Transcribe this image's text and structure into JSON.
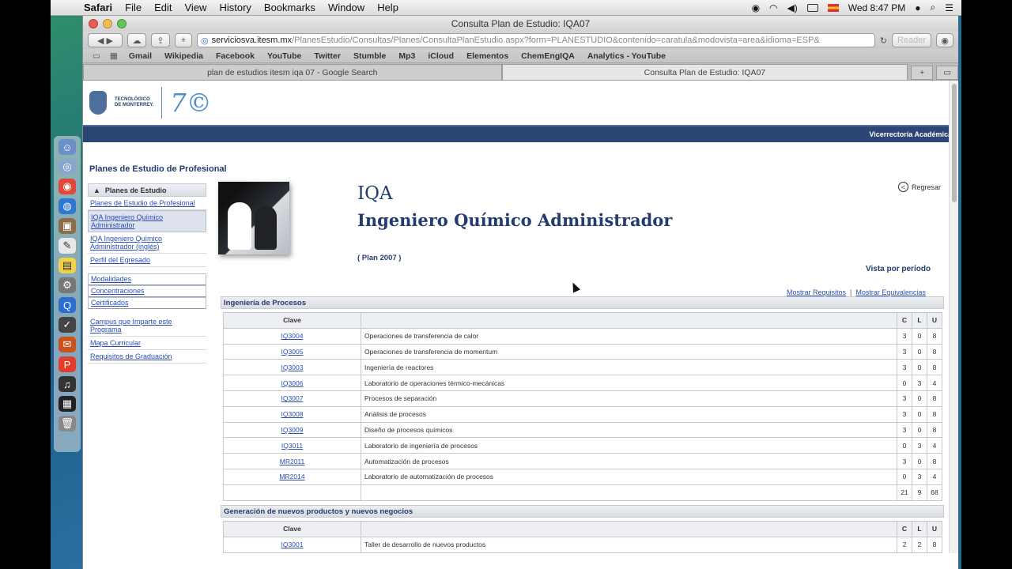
{
  "menubar": {
    "app": "Safari",
    "items": [
      "File",
      "Edit",
      "View",
      "History",
      "Bookmarks",
      "Window",
      "Help"
    ],
    "clock": "Wed 8:47 PM"
  },
  "window": {
    "title": "Consulta Plan de Estudio: IQA07"
  },
  "toolbar": {
    "url_host": "serviciosva.itesm.mx",
    "url_path": "/PlanesEstudio/Consultas/Planes/ConsultaPlanEstudio.aspx?form=PLANESTUDIO&contenido=caratula&modovista=area&idioma=ESP&",
    "reader_label": "Reader"
  },
  "bookmarks": [
    "Gmail",
    "Wikipedia",
    "Facebook",
    "YouTube",
    "Twitter",
    "Stumble",
    "Mp3",
    "iCloud",
    "Elementos",
    "ChemEngIQA",
    "Analytics - YouTube"
  ],
  "tabs": [
    {
      "label": "plan de estudios itesm iqa 07 - Google Search"
    },
    {
      "label": "Consulta Plan de Estudio: IQA07"
    }
  ],
  "page": {
    "banner_right": "Vicerrectoría Académica",
    "section_title": "Planes de Estudio de Profesional",
    "sidebar": {
      "header": "Planes de Estudio",
      "items": [
        "Planes de Estudio de Profesional",
        "IQA Ingeniero Químico Administrador",
        "IQA Ingeniero Químico Administrador (inglés)",
        "Perfil del Egresado"
      ],
      "boxes": [
        "Modalidades",
        "Concentraciones",
        "Certificados"
      ],
      "links": [
        "Campus que Imparte este Programa",
        "Mapa Curricular",
        "Requisitos de Graduación"
      ]
    },
    "program_code": "IQA",
    "program_name": "Ingeniero Químico Administrador",
    "plan": "( Plan 2007 )",
    "back_label": "Regresar",
    "view_label": "Vista por período",
    "link_requisitos": "Mostrar Requisitos",
    "link_separator": "|",
    "link_equivalencias": "Mostrar Equivalencias",
    "columns": {
      "clave": "Clave",
      "c": "C",
      "l": "L",
      "u": "U"
    },
    "groups": [
      {
        "name": "Ingeniería de Procesos",
        "rows": [
          {
            "clave": "IQ3004",
            "materia": "Operaciones de transferencia de calor",
            "c": "3",
            "l": "0",
            "u": "8"
          },
          {
            "clave": "IQ3005",
            "materia": "Operaciones de transferencia de momentum",
            "c": "3",
            "l": "0",
            "u": "8"
          },
          {
            "clave": "IQ3003",
            "materia": "Ingeniería de reactores",
            "c": "3",
            "l": "0",
            "u": "8"
          },
          {
            "clave": "IQ3006",
            "materia": "Laboratorio de operaciones térmico-mecánicas",
            "c": "0",
            "l": "3",
            "u": "4"
          },
          {
            "clave": "IQ3007",
            "materia": "Procesos de separación",
            "c": "3",
            "l": "0",
            "u": "8"
          },
          {
            "clave": "IQ3008",
            "materia": "Análisis de procesos",
            "c": "3",
            "l": "0",
            "u": "8"
          },
          {
            "clave": "IQ3009",
            "materia": "Diseño de procesos químicos",
            "c": "3",
            "l": "0",
            "u": "8"
          },
          {
            "clave": "IQ3011",
            "materia": "Laboratorio de ingeniería de procesos",
            "c": "0",
            "l": "3",
            "u": "4"
          },
          {
            "clave": "MR2011",
            "materia": "Automatización de procesos",
            "c": "3",
            "l": "0",
            "u": "8"
          },
          {
            "clave": "MR2014",
            "materia": "Laboratorio de automatización de procesos",
            "c": "0",
            "l": "3",
            "u": "4"
          }
        ],
        "totals": {
          "c": "21",
          "l": "9",
          "u": "68"
        }
      },
      {
        "name": "Generación de nuevos productos y nuevos negocios",
        "rows": [
          {
            "clave": "IQ3001",
            "materia": "Taller de desarrollo de nuevos productos",
            "c": "2",
            "l": "2",
            "u": "8"
          }
        ]
      }
    ]
  },
  "icons": {
    "apple": "apple-icon",
    "wifi": "wifi-icon",
    "volume": "volume-icon",
    "battery": "battery-icon",
    "search": "search-icon"
  }
}
